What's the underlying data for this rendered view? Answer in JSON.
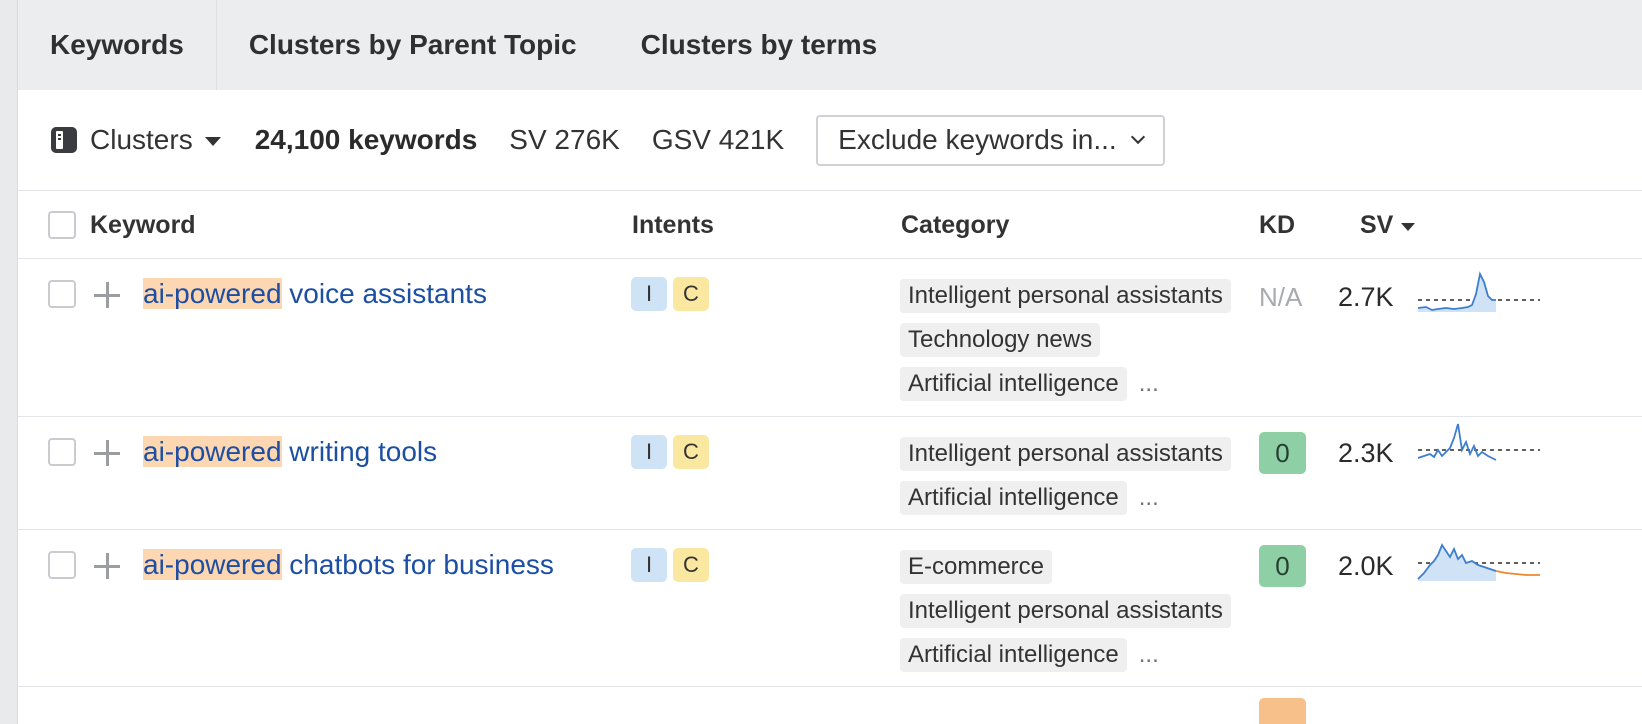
{
  "tabs": [
    "Keywords",
    "Clusters by Parent Topic",
    "Clusters by terms"
  ],
  "toolbar": {
    "clusters_label": "Clusters",
    "keyword_count": "24,100 keywords",
    "sv": "SV 276K",
    "gsv": "GSV 421K",
    "exclude_label": "Exclude keywords in..."
  },
  "columns": {
    "keyword": "Keyword",
    "intents": "Intents",
    "category": "Category",
    "kd": "KD",
    "sv": "SV"
  },
  "rows": [
    {
      "highlight": "ai-powered",
      "rest": " voice assistants",
      "intents": [
        "I",
        "C"
      ],
      "categories": [
        "Intelligent personal assistants",
        "Technology news",
        "Artificial intelligence"
      ],
      "more": "...",
      "kd": "N/A",
      "sv": "2.7K"
    },
    {
      "highlight": "ai-powered",
      "rest": " writing tools",
      "intents": [
        "I",
        "C"
      ],
      "categories": [
        "Intelligent personal assistants",
        "Artificial intelligence"
      ],
      "more": "...",
      "kd": "0",
      "sv": "2.3K"
    },
    {
      "highlight": "ai-powered",
      "rest": " chatbots for business",
      "intents": [
        "I",
        "C"
      ],
      "categories": [
        "E-commerce",
        "Intelligent personal assistants",
        "Artificial intelligence"
      ],
      "more": "...",
      "kd": "0",
      "sv": "2.0K"
    }
  ],
  "colors": {
    "link": "#1c4fa3",
    "highlight": "#fdd6b2",
    "intent_i": "#cfe3f6",
    "intent_c": "#fbe8a0",
    "kd_easy": "#8fcfa5",
    "spark_line": "#3c7ecf",
    "spark_forecast": "#f0862f"
  }
}
